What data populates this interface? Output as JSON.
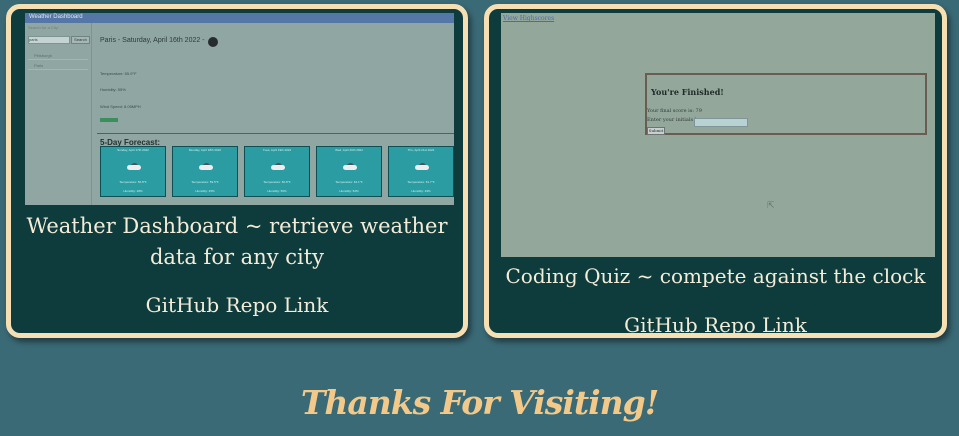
{
  "projects": [
    {
      "caption": "Weather Dashboard ~ retrieve weather data for any city",
      "link": "GitHub Repo Link",
      "screenshot": {
        "app_title": "Weather Dashboard",
        "search_label": "Search for a City:",
        "search_value": "paris",
        "search_button": "Search",
        "history": [
          "Pittsburgh",
          "Paris"
        ],
        "current": {
          "heading": "Paris - Saturday, April 16th 2022 -",
          "temperature": "Temperature: 55.9°F",
          "humidity": "Humidity: 55%",
          "wind": "Wind Speed: 8.05MPH"
        },
        "forecast_heading": "5-Day Forecast:",
        "forecast": [
          {
            "date": "Sunday, April 17th 2022",
            "temp": "Temperature: 56.8°F",
            "humidity": "Humidity: 48%"
          },
          {
            "date": "Monday, April 18th 2022",
            "temp": "Temperature: 59.5°F",
            "humidity": "Humidity: 45%"
          },
          {
            "date": "Tues, April 19th 2022",
            "temp": "Temperature: 60.8°F",
            "humidity": "Humidity: 50%"
          },
          {
            "date": "Wed, April 20th 2022",
            "temp": "Temperature: 62.1°F",
            "humidity": "Humidity: 52%"
          },
          {
            "date": "Thu, April 21st 2022",
            "temp": "Temperature: 61.7°F",
            "humidity": "Humidity: 49%"
          }
        ]
      }
    },
    {
      "caption": "Coding Quiz ~ compete against the clock",
      "link": "GitHub Repo Link",
      "screenshot": {
        "top_link": "View Highscores",
        "finished_title": "You're Finished!",
        "final_score": "Your final score is: 79",
        "initials_label": "Enter your initials here:",
        "submit_label": "Submit"
      }
    }
  ],
  "footer": {
    "thanks": "Thanks For Visiting!"
  },
  "colors": {
    "background": "#3a6a76",
    "card": "#0e3b3c",
    "border": "#f6e0b3",
    "accent_text": "#f3c98a"
  }
}
